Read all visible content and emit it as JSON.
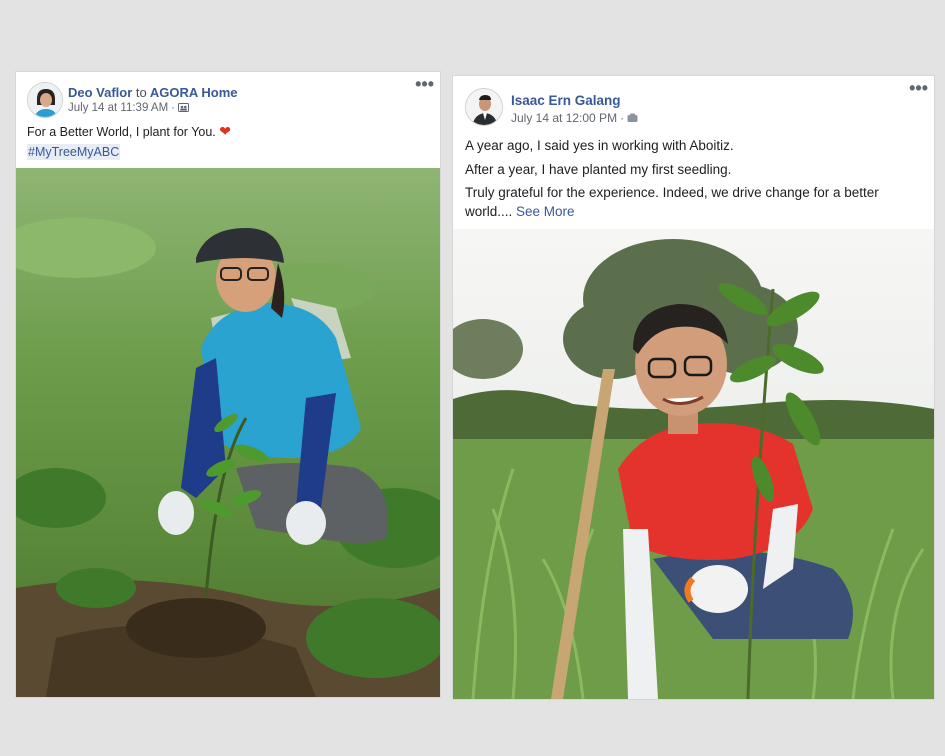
{
  "posts": [
    {
      "author": "Deo Vaflor",
      "connector": "to",
      "target": "AGORA Home",
      "timestamp": "July 14 at 11:39 AM",
      "audience_icon": "group-audience-icon",
      "text": "For a Better World, I plant for You.",
      "emoji": "❤",
      "hashtag": "#MyTreeMyABC",
      "more_label": "•••",
      "photo_icon": "woman-planting-seedling-photo"
    },
    {
      "author": "Isaac Ern Galang",
      "timestamp": "July 14 at 12:00 PM",
      "audience_icon": "public-audience-icon",
      "lines": [
        "A year ago, I said yes in working with Aboitiz.",
        "After a year, I have planted my first seedling.",
        "Truly grateful for the experience. Indeed, we drive change for a better",
        "world...."
      ],
      "see_more": "See More",
      "more_label": "•••",
      "photo_icon": "man-planting-seedling-photo"
    }
  ],
  "colors": {
    "link": "#385898",
    "meta": "#616770",
    "background": "#e3e3e3",
    "heart": "#e0321f"
  }
}
